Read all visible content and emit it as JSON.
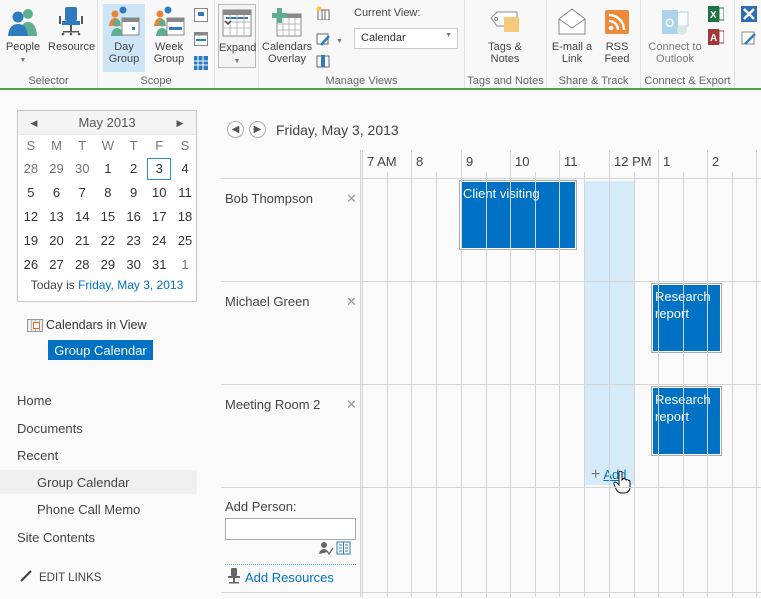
{
  "ribbon": {
    "groups": [
      {
        "label": "Selector"
      },
      {
        "label": "Scope"
      },
      {
        "label": "Manage Views"
      },
      {
        "label": "Tags and Notes"
      },
      {
        "label": "Share & Track"
      },
      {
        "label": "Connect & Export"
      }
    ],
    "buttons": {
      "people": "People",
      "resource": "Resource",
      "day_group_1": "Day",
      "day_group_2": "Group",
      "week_group_1": "Week",
      "week_group_2": "Group",
      "expand": "Expand",
      "calendars_overlay_1": "Calendars",
      "calendars_overlay_2": "Overlay",
      "tags_notes_1": "Tags &",
      "tags_notes_2": "Notes",
      "email_link_1": "E-mail a",
      "email_link_2": "Link",
      "rss_1": "RSS",
      "rss_2": "Feed",
      "outlook_1": "Connect to",
      "outlook_2": "Outlook"
    },
    "current_view_label": "Current View:",
    "current_view_value": "Calendar",
    "selected_scope": "Day Group"
  },
  "mini_calendar": {
    "month_label": "May 2013",
    "weekdays": [
      "S",
      "M",
      "T",
      "W",
      "T",
      "F",
      "S"
    ],
    "weeks": [
      [
        "28",
        "29",
        "30",
        "1",
        "2",
        "3",
        "4"
      ],
      [
        "5",
        "6",
        "7",
        "8",
        "9",
        "10",
        "11"
      ],
      [
        "12",
        "13",
        "14",
        "15",
        "16",
        "17",
        "18"
      ],
      [
        "19",
        "20",
        "21",
        "22",
        "23",
        "24",
        "25"
      ],
      [
        "26",
        "27",
        "28",
        "29",
        "30",
        "31",
        "1"
      ]
    ],
    "other_month_cells": [
      "0-0",
      "0-1",
      "0-2",
      "4-6"
    ],
    "selected_cell": "0-5",
    "today_prefix": "Today is ",
    "today_link": "Friday, May 3, 2013"
  },
  "calendars_in_view": {
    "label": "Calendars in View",
    "items": [
      "Group Calendar"
    ]
  },
  "quick_launch": {
    "items": [
      {
        "label": "Home",
        "level": 0
      },
      {
        "label": "Documents",
        "level": 0
      },
      {
        "label": "Recent",
        "level": 0
      },
      {
        "label": "Group Calendar",
        "level": 1,
        "selected": true
      },
      {
        "label": "Phone Call Memo",
        "level": 1
      },
      {
        "label": "Site Contents",
        "level": 0
      }
    ],
    "edit_links": "EDIT LINKS"
  },
  "main": {
    "date_title": "Friday, May 3, 2013",
    "hours": [
      "7 AM",
      "8",
      "9",
      "10",
      "11",
      "12 PM",
      "1",
      "2"
    ],
    "rows": [
      {
        "name": "Bob Thompson",
        "events": [
          {
            "title": "Client visiting",
            "start": "9:00",
            "end": "11:30"
          }
        ]
      },
      {
        "name": "Michael Green",
        "events": [
          {
            "title": "Research report",
            "start": "1:00 PM",
            "end": "2:30 PM"
          }
        ]
      },
      {
        "name": "Meeting Room 2",
        "events": [
          {
            "title": "Research report",
            "start": "1:00 PM",
            "end": "2:30 PM"
          }
        ]
      }
    ],
    "highlight_slot": {
      "start": "11:30",
      "end": "12:30 PM"
    },
    "add_link": "Add",
    "add_person_label": "Add Person:",
    "add_person_value": "",
    "add_resources": "Add Resources"
  },
  "colors": {
    "accent": "#0072c6",
    "event_bg": "#0072c6",
    "slot_highlight": "#d5ebf9",
    "ribbon_border": "#4ca44c"
  }
}
